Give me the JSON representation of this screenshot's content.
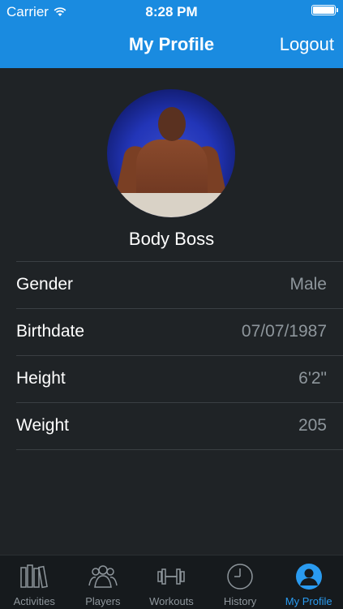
{
  "status_bar": {
    "carrier": "Carrier",
    "time": "8:28 PM",
    "battery_level": 1.0
  },
  "nav": {
    "title": "My Profile",
    "logout_label": "Logout"
  },
  "profile": {
    "name": "Body Boss"
  },
  "fields": [
    {
      "label": "Gender",
      "value": "Male"
    },
    {
      "label": "Birthdate",
      "value": "07/07/1987"
    },
    {
      "label": "Height",
      "value": "6'2\""
    },
    {
      "label": "Weight",
      "value": "205"
    }
  ],
  "tabs": [
    {
      "label": "Activities",
      "icon": "books-icon"
    },
    {
      "label": "Players",
      "icon": "group-icon"
    },
    {
      "label": "Workouts",
      "icon": "dumbbell-icon"
    },
    {
      "label": "History",
      "icon": "clock-icon"
    },
    {
      "label": "My Profile",
      "icon": "person-icon",
      "active": true
    }
  ],
  "colors": {
    "accent": "#1a8be0",
    "tab_active": "#2a9bf0",
    "background": "#1f2326"
  }
}
